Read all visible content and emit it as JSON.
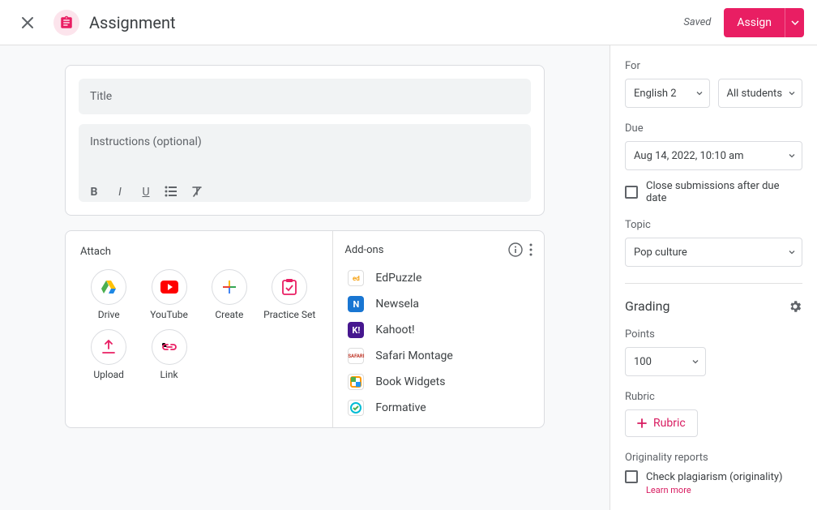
{
  "header": {
    "title": "Assignment",
    "saved": "Saved",
    "assign": "Assign"
  },
  "editor": {
    "title_placeholder": "Title",
    "instructions_placeholder": "Instructions (optional)"
  },
  "attach": {
    "label": "Attach",
    "items": [
      "Drive",
      "YouTube",
      "Create",
      "Practice Set",
      "Upload",
      "Link"
    ]
  },
  "addons": {
    "label": "Add-ons",
    "items": [
      "EdPuzzle",
      "Newsela",
      "Kahoot!",
      "Safari Montage",
      "Book Widgets",
      "Formative"
    ]
  },
  "sidebar": {
    "for_label": "For",
    "class": "English 2",
    "students": "All students",
    "due_label": "Due",
    "due_value": "Aug 14, 2022, 10:10 am",
    "close_submissions": "Close submissions after due date",
    "topic_label": "Topic",
    "topic_value": "Pop culture",
    "grading_label": "Grading",
    "points_label": "Points",
    "points_value": "100",
    "rubric_label": "Rubric",
    "rubric_btn": "Rubric",
    "originality_label": "Originality reports",
    "originality_check": "Check plagiarism (originality)",
    "learn_more": "Learn more"
  }
}
